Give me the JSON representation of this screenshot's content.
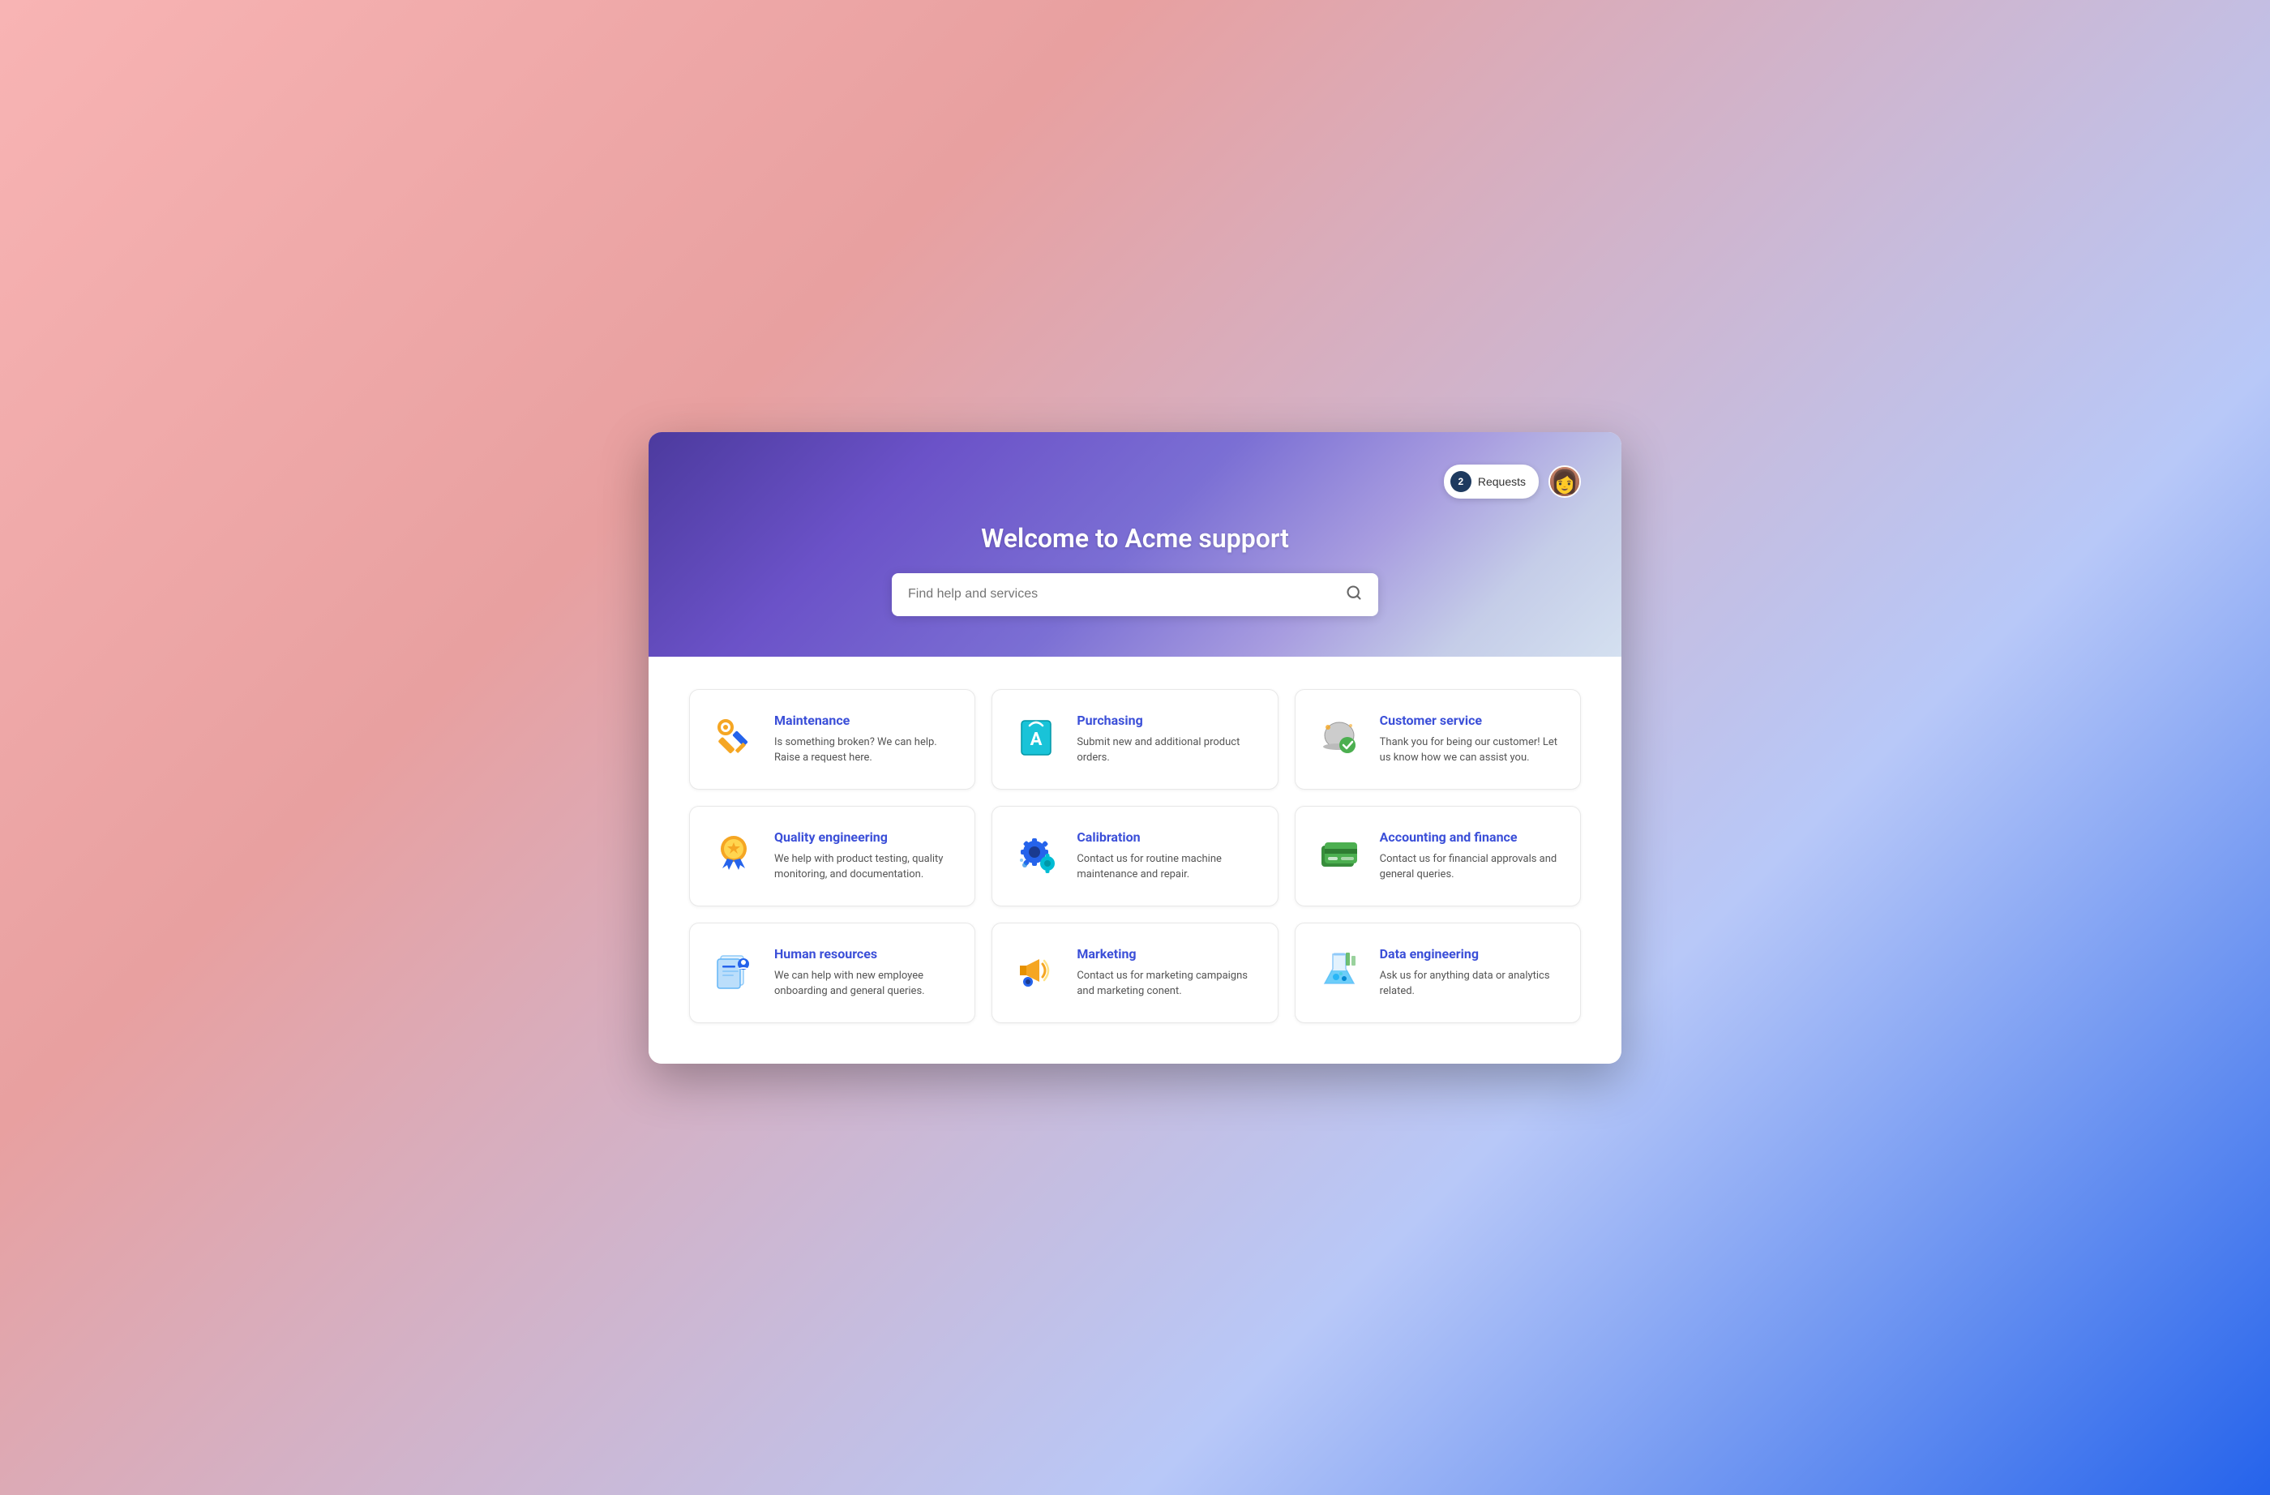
{
  "header": {
    "title": "Welcome to Acme support",
    "search_placeholder": "Find help and services",
    "requests_label": "Requests",
    "requests_count": "2"
  },
  "cards": [
    {
      "id": "maintenance",
      "title": "Maintenance",
      "description": "Is something broken? We can help. Raise a request here.",
      "icon": "maintenance"
    },
    {
      "id": "purchasing",
      "title": "Purchasing",
      "description": "Submit new and additional product orders.",
      "icon": "purchasing"
    },
    {
      "id": "customer-service",
      "title": "Customer service",
      "description": "Thank you for being our customer! Let us know how we can assist you.",
      "icon": "customer-service"
    },
    {
      "id": "quality-engineering",
      "title": "Quality engineering",
      "description": "We help with product testing, quality monitoring, and documentation.",
      "icon": "quality-engineering"
    },
    {
      "id": "calibration",
      "title": "Calibration",
      "description": "Contact us for routine machine maintenance and repair.",
      "icon": "calibration"
    },
    {
      "id": "accounting-finance",
      "title": "Accounting and finance",
      "description": "Contact us for financial approvals and general queries.",
      "icon": "accounting"
    },
    {
      "id": "human-resources",
      "title": "Human resources",
      "description": "We can help with new employee onboarding and general queries.",
      "icon": "hr"
    },
    {
      "id": "marketing",
      "title": "Marketing",
      "description": "Contact us for marketing campaigns and marketing conent.",
      "icon": "marketing"
    },
    {
      "id": "data-engineering",
      "title": "Data engineering",
      "description": "Ask us for anything data or analytics related.",
      "icon": "data-engineering"
    }
  ]
}
